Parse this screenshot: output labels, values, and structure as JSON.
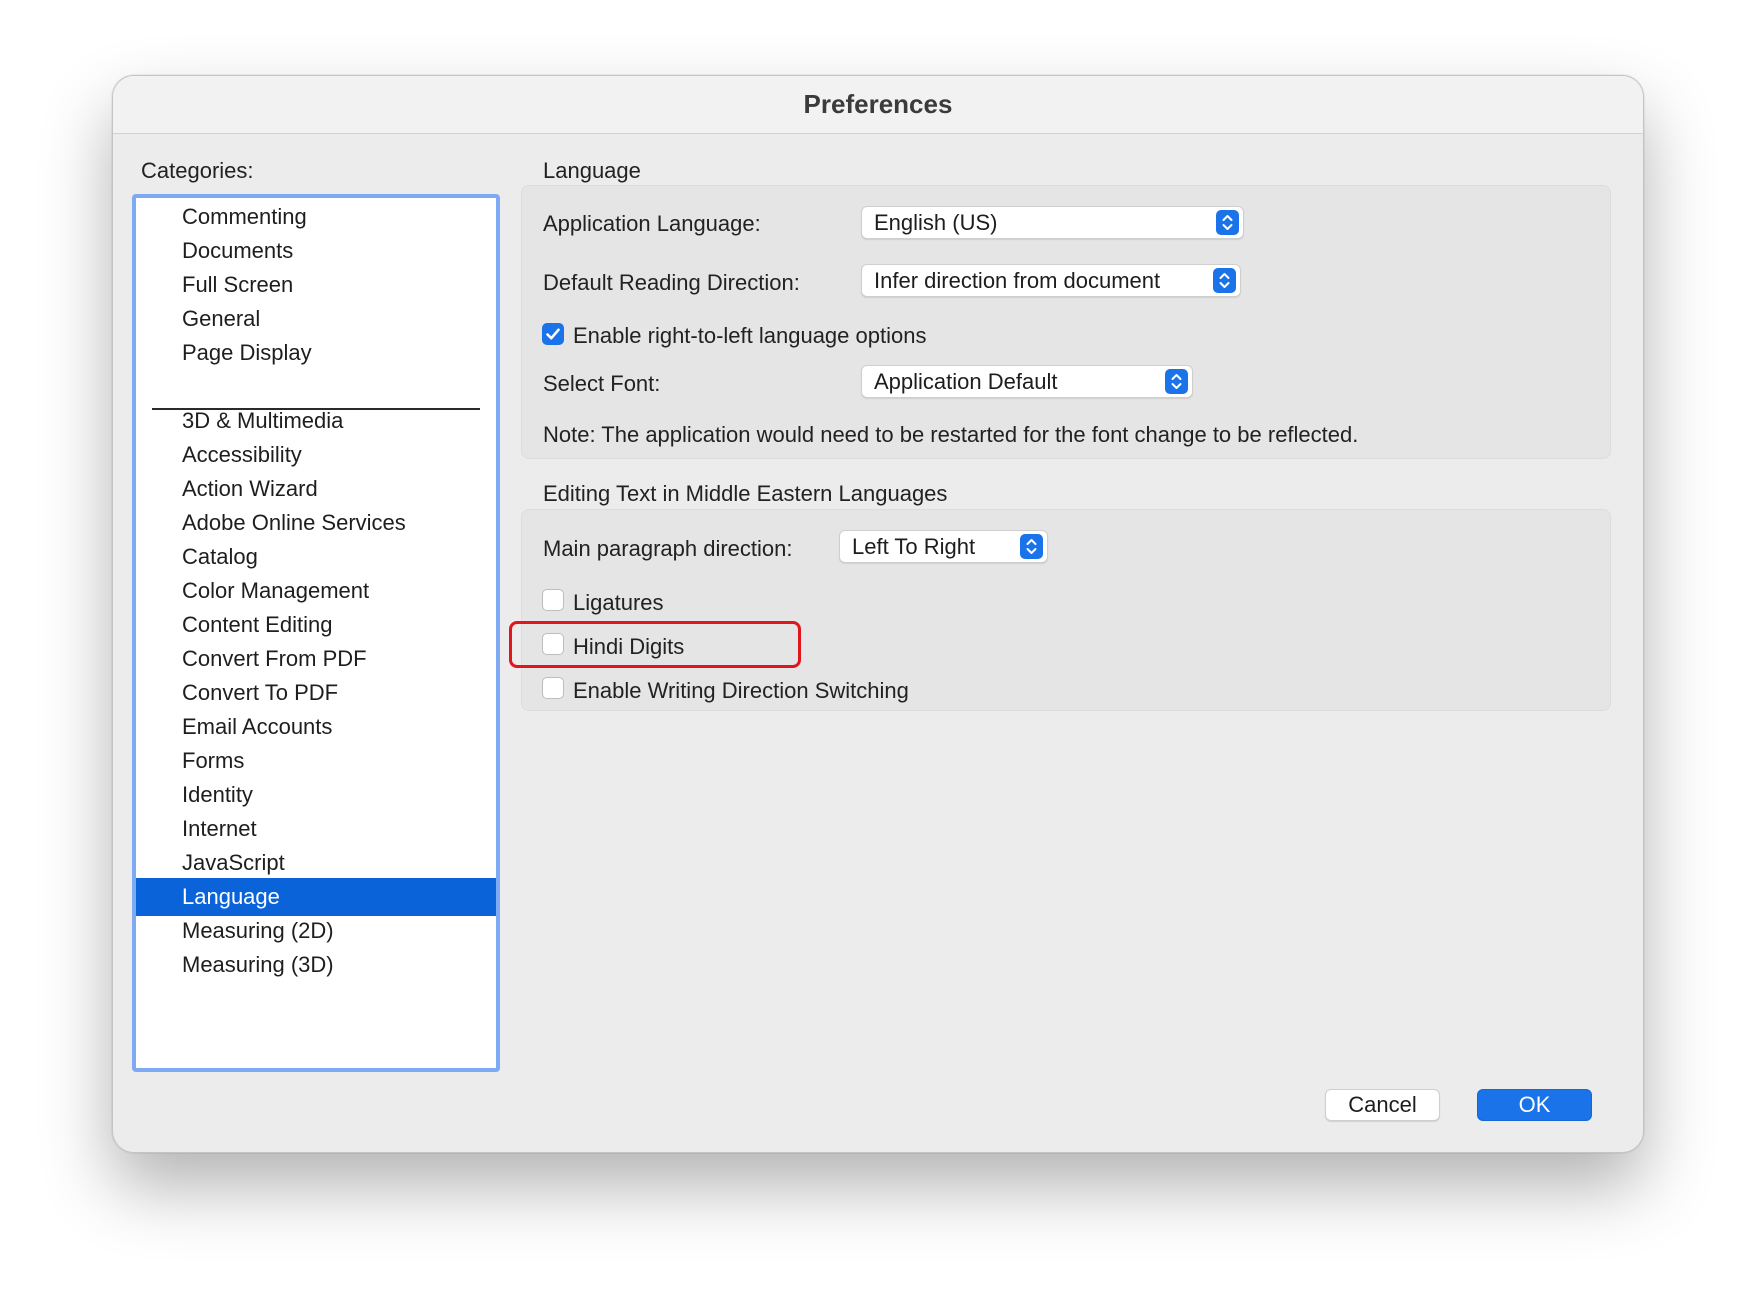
{
  "window": {
    "title": "Preferences"
  },
  "categories": {
    "label": "Categories:",
    "group1": [
      "Commenting",
      "Documents",
      "Full Screen",
      "General",
      "Page Display"
    ],
    "group2": [
      "3D & Multimedia",
      "Accessibility",
      "Action Wizard",
      "Adobe Online Services",
      "Catalog",
      "Color Management",
      "Content Editing",
      "Convert From PDF",
      "Convert To PDF",
      "Email Accounts",
      "Forms",
      "Identity",
      "Internet",
      "JavaScript",
      "Language",
      "Measuring (2D)",
      "Measuring (3D)"
    ],
    "selected": "Language"
  },
  "language_section": {
    "title": "Language",
    "app_language_label": "Application Language:",
    "app_language_value": "English (US)",
    "reading_direction_label": "Default Reading Direction:",
    "reading_direction_value": "Infer direction from document",
    "rtl_checkbox_label": "Enable right-to-left language options",
    "rtl_checked": true,
    "select_font_label": "Select Font:",
    "select_font_value": "Application Default",
    "note": "Note: The application would need to be restarted for the font change to be reflected."
  },
  "middle_eastern_section": {
    "title": "Editing Text in Middle Eastern Languages",
    "paragraph_direction_label": "Main paragraph direction:",
    "paragraph_direction_value": "Left To Right",
    "ligatures_label": "Ligatures",
    "ligatures_checked": false,
    "hindi_digits_label": "Hindi Digits",
    "hindi_digits_checked": false,
    "writing_direction_label": "Enable Writing Direction Switching",
    "writing_direction_checked": false
  },
  "buttons": {
    "cancel": "Cancel",
    "ok": "OK"
  },
  "colors": {
    "accent": "#1a73e8",
    "selection": "#0a63d8",
    "highlight_annotation": "#e0151e",
    "list_focus_ring": "#7fa9f3"
  }
}
